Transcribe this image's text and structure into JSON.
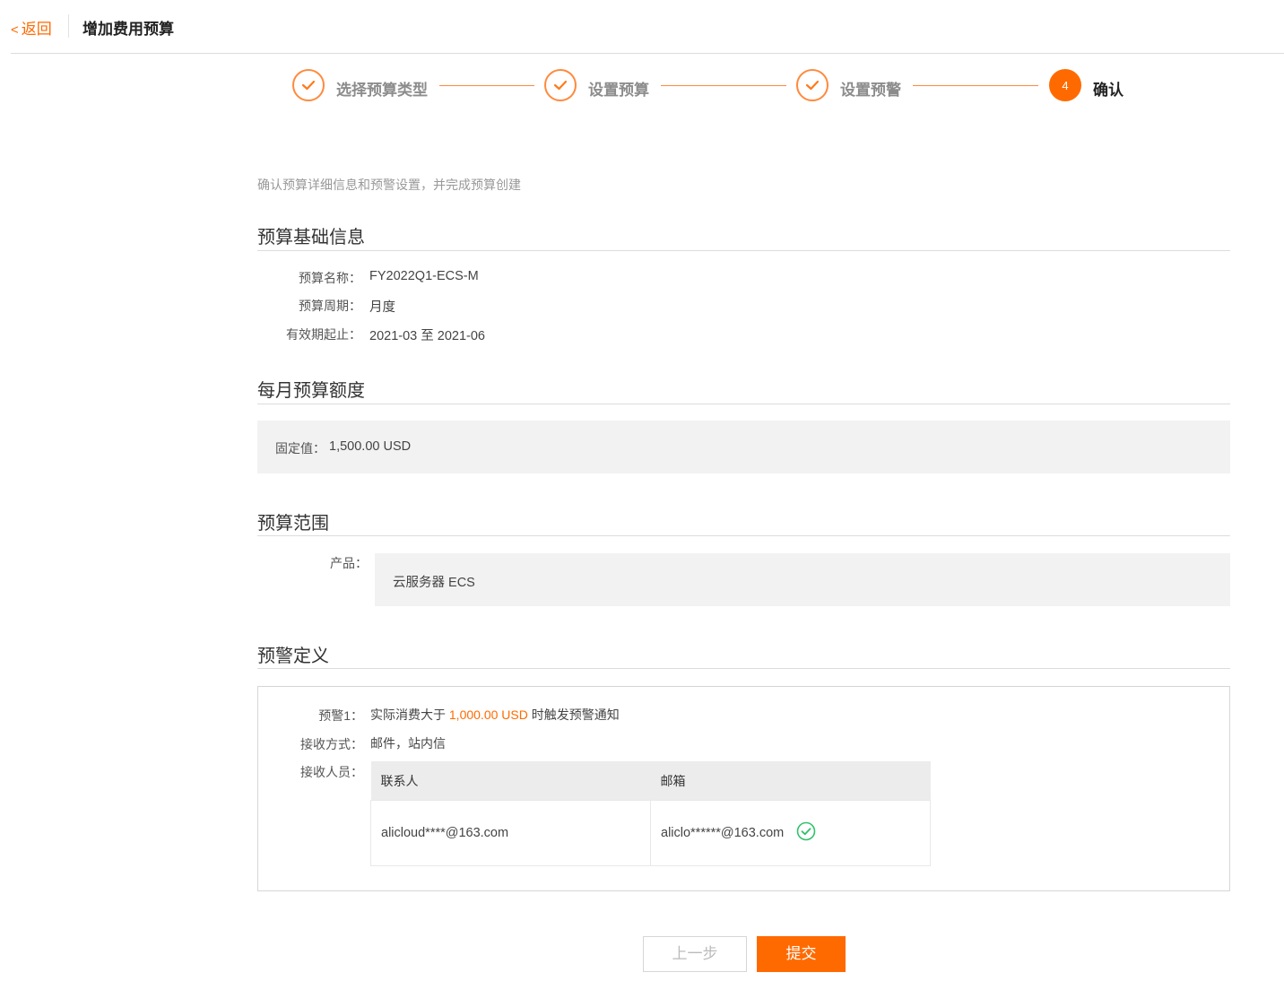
{
  "header": {
    "back_chevron": "<",
    "back_label": "返回",
    "title": "增加费用预算"
  },
  "steps": [
    {
      "label": "选择预算类型",
      "status": "done"
    },
    {
      "label": "设置预算",
      "status": "done"
    },
    {
      "label": "设置预警",
      "status": "done"
    },
    {
      "number": "4",
      "label": "确认",
      "status": "active"
    }
  ],
  "intro": "确认预算详细信息和预警设置，并完成预算创建",
  "basic": {
    "title": "预算基础信息",
    "name_label": "预算名称：",
    "name_value": "FY2022Q1-ECS-M",
    "period_label": "预算周期：",
    "period_value": "月度",
    "validity_label": "有效期起止：",
    "validity_value": "2021-03 至 2021-06"
  },
  "monthly": {
    "title": "每月预算额度",
    "fixed_label": "固定值：",
    "fixed_value": "1,500.00 USD"
  },
  "scope": {
    "title": "预算范围",
    "product_label": "产品：",
    "product_value": "云服务器 ECS"
  },
  "alerts": {
    "title": "预警定义",
    "alert1_label": "预警1：",
    "alert1_prefix": "实际消费大于",
    "alert1_amount": "1,000.00 USD",
    "alert1_suffix": "时触发预警通知",
    "method_label": "接收方式：",
    "method_value": "邮件，站内信",
    "recipients_label": "接收人员：",
    "table_headers": {
      "contact": "联系人",
      "email": "邮箱"
    },
    "recipients": [
      {
        "contact": "alicloud****@163.com",
        "email": "aliclo******@163.com",
        "verified": true
      }
    ]
  },
  "buttons": {
    "prev": "上一步",
    "submit": "提交"
  },
  "colors": {
    "accent": "#ff6a00",
    "verified": "#2ec26a"
  }
}
